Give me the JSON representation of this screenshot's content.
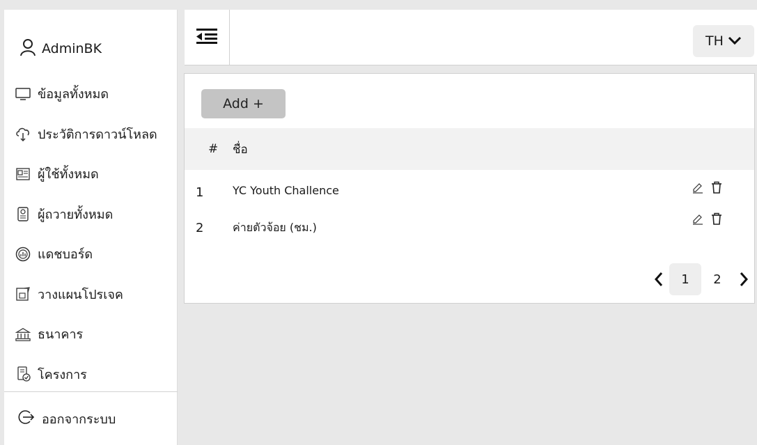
{
  "sidebar": {
    "user": "AdminBK",
    "items": [
      {
        "label": "ข้อมูลทั้งหมด",
        "icon": "monitor-icon"
      },
      {
        "label": "ประวัติการดาวน์โหลด",
        "icon": "cloud-download-icon"
      },
      {
        "label": "ผู้ใช้ทั้งหมด",
        "icon": "id-card-icon"
      },
      {
        "label": "ผู้ถวายทั้งหมด",
        "icon": "badge-icon"
      },
      {
        "label": "แดชบอร์ด",
        "icon": "dashboard-icon"
      },
      {
        "label": "วางแผนโปรเจค",
        "icon": "blueprint-icon"
      },
      {
        "label": "ธนาคาร",
        "icon": "bank-icon"
      },
      {
        "label": "โครงการ",
        "icon": "project-icon"
      }
    ],
    "logout": "ออกจากระบบ"
  },
  "topbar": {
    "lang": "TH"
  },
  "main": {
    "add_label": "Add +",
    "columns": [
      "#",
      "ชื่อ"
    ],
    "rows": [
      {
        "num": "1",
        "name": "YC Youth Challence"
      },
      {
        "num": "2",
        "name": "ค่ายตัวจ้อย (ชม.)"
      }
    ],
    "pagination": {
      "pages": [
        "1",
        "2"
      ],
      "current": "1"
    }
  }
}
